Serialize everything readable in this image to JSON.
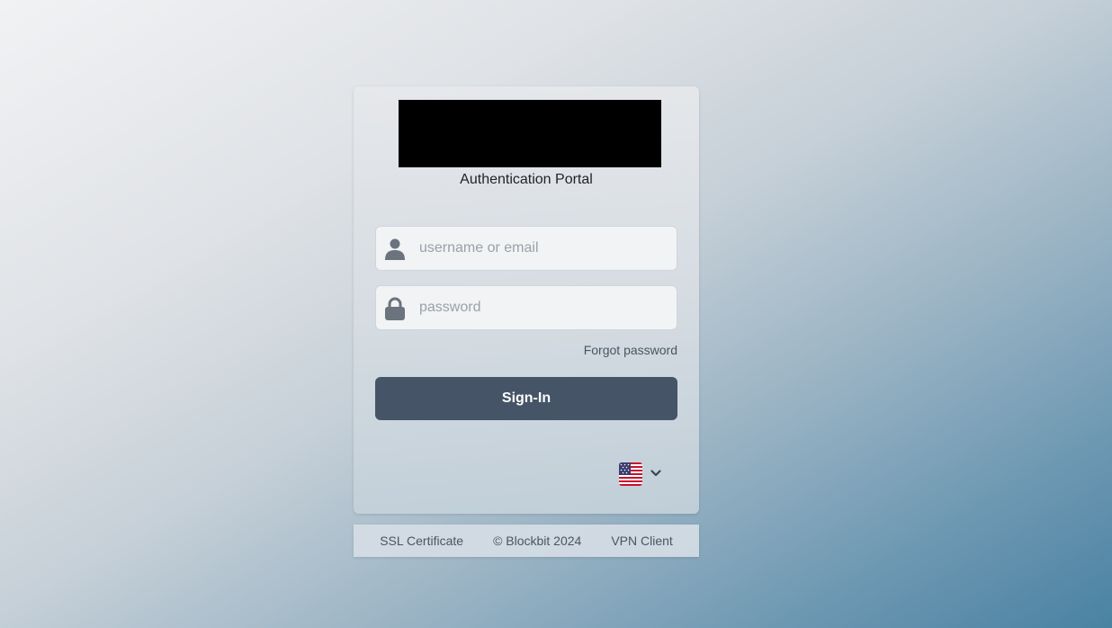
{
  "portal": {
    "subtitle": "Authentication Portal"
  },
  "login": {
    "username_placeholder": "username or email",
    "username_value": "",
    "password_placeholder": "password",
    "password_value": "",
    "forgot_label": "Forgot password",
    "signin_label": "Sign-In"
  },
  "language": {
    "selected_icon": "us-flag-icon"
  },
  "footer": {
    "ssl_label": "SSL Certificate",
    "copyright": "© Blockbit 2024",
    "vpn_label": "VPN Client"
  },
  "colors": {
    "button_bg": "#455466",
    "icon": "#6b737d"
  }
}
